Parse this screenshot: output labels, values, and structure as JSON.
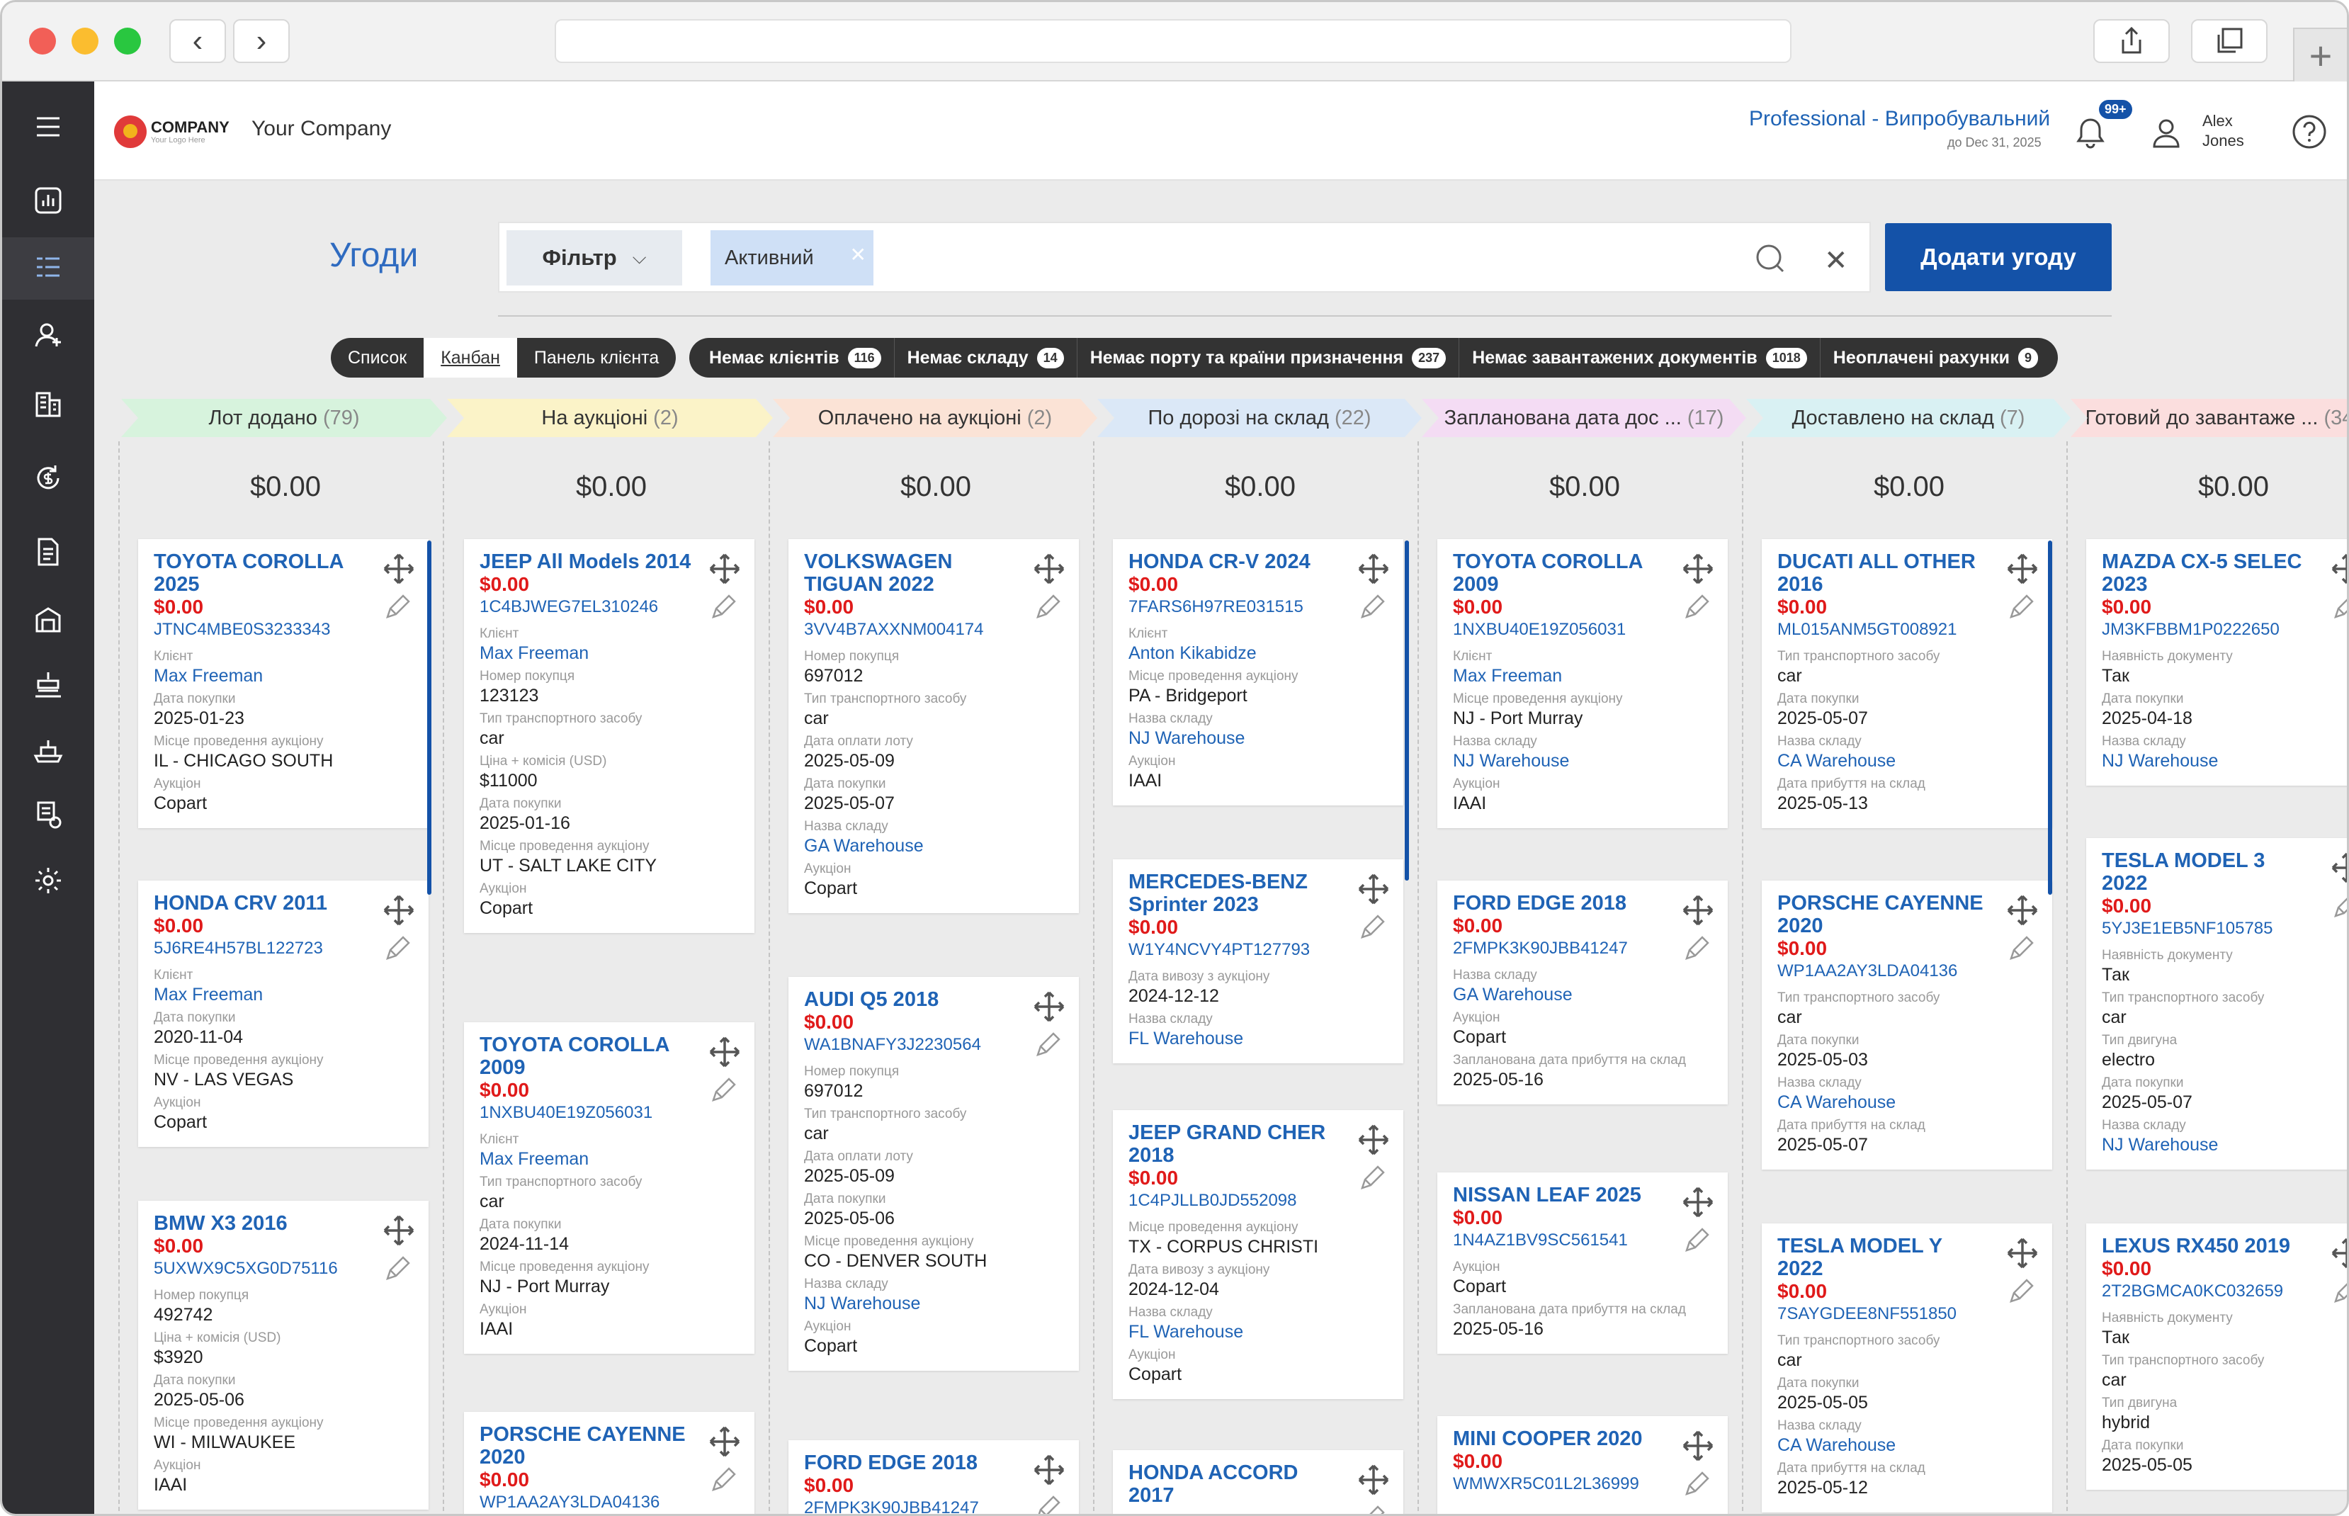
{
  "topbar": {
    "logo_text": "COMPANY",
    "logo_sub": "Your Logo Here",
    "company_name": "Your Company",
    "plan": "Professional - Випробувальний",
    "plan_until": "до Dec 31, 2025",
    "notifications_badge": "99+",
    "user_first": "Alex",
    "user_last": "Jones"
  },
  "page": {
    "title": "Угоди",
    "filter_label": "Фільтр",
    "active_chip": "Активний",
    "add_button": "Додати угоду"
  },
  "view_toggle": [
    "Список",
    "Канбан",
    "Панель клієнта"
  ],
  "quick_filters": [
    {
      "label": "Немає клієнтів",
      "count": "116"
    },
    {
      "label": "Немає складу",
      "count": "14"
    },
    {
      "label": "Немає порту та країни призначення",
      "count": "237"
    },
    {
      "label": "Немає завантажених документів",
      "count": "1018"
    },
    {
      "label": "Неоплачені рахунки",
      "count": "9"
    }
  ],
  "columns": [
    {
      "stage": "Лот додано",
      "count": "(79)",
      "color": "#d7f3dd",
      "amount": "$0.00",
      "cards": [
        {
          "title": "TOYOTA COROLLA 2025",
          "price": "$0.00",
          "vin": "JTNC4MBE0S3233343",
          "fields": [
            [
              "Клієнт",
              "Max Freeman",
              true
            ],
            [
              "Дата покупки",
              "2025-01-23",
              false
            ],
            [
              "Місце проведення аукціону",
              "IL - CHICAGO SOUTH",
              false
            ],
            [
              "Аукціон",
              "Copart",
              false
            ]
          ]
        },
        {
          "title": "HONDA CRV 2011",
          "price": "$0.00",
          "vin": "5J6RE4H57BL122723",
          "fields": [
            [
              "Клієнт",
              "Max Freeman",
              true
            ],
            [
              "Дата покупки",
              "2020-11-04",
              false
            ],
            [
              "Місце проведення аукціону",
              "NV - LAS VEGAS",
              false
            ],
            [
              "Аукціон",
              "Copart",
              false
            ]
          ]
        },
        {
          "title": "BMW X3 2016",
          "price": "$0.00",
          "vin": "5UXWX9C5XG0D75116",
          "fields": [
            [
              "Номер покупця",
              "492742",
              false
            ],
            [
              "Ціна + комісія (USD)",
              "$3920",
              false
            ],
            [
              "Дата покупки",
              "2025-05-06",
              false
            ],
            [
              "Місце проведення аукціону",
              "WI - MILWAUKEE",
              false
            ],
            [
              "Аукціон",
              "IAAI",
              false
            ]
          ]
        }
      ]
    },
    {
      "stage": "На аукціоні",
      "count": "(2)",
      "color": "#fbf3c8",
      "amount": "$0.00",
      "cards": [
        {
          "title": "JEEP All Models 2014",
          "price": "$0.00",
          "vin": "1C4BJWEG7EL310246",
          "fields": [
            [
              "Клієнт",
              "Max Freeman",
              true
            ],
            [
              "Номер покупця",
              "123123",
              false
            ],
            [
              "Тип транспортного засобу",
              "car",
              false
            ],
            [
              "Ціна + комісія (USD)",
              "$11000",
              false
            ],
            [
              "Дата покупки",
              "2025-01-16",
              false
            ],
            [
              "Місце проведення аукціону",
              "UT - SALT LAKE CITY",
              false
            ],
            [
              "Аукціон",
              "Copart",
              false
            ]
          ]
        },
        {
          "title": "TOYOTA COROLLA 2009",
          "price": "$0.00",
          "vin": "1NXBU40E19Z056031",
          "fields": [
            [
              "Клієнт",
              "Max Freeman",
              true
            ],
            [
              "Тип транспортного засобу",
              "car",
              false
            ],
            [
              "Дата покупки",
              "2024-11-14",
              false
            ],
            [
              "Місце проведення аукціону",
              "NJ - Port Murray",
              false
            ],
            [
              "Аукціон",
              "IAAI",
              false
            ]
          ]
        },
        {
          "title": "PORSCHE CAYENNE 2020",
          "price": "$0.00",
          "vin": "WP1AA2AY3LDA04136",
          "fields": []
        }
      ]
    },
    {
      "stage": "Оплачено на аукціоні",
      "count": "(2)",
      "color": "#fbe3d6",
      "amount": "$0.00",
      "cards": [
        {
          "title": "VOLKSWAGEN TIGUAN 2022",
          "price": "$0.00",
          "vin": "3VV4B7AXXNM004174",
          "fields": [
            [
              "Номер покупця",
              "697012",
              false
            ],
            [
              "Тип транспортного засобу",
              "car",
              false
            ],
            [
              "Дата оплати лоту",
              "2025-05-09",
              false
            ],
            [
              "Дата покупки",
              "2025-05-07",
              false
            ],
            [
              "Назва складу",
              "GA Warehouse",
              true
            ],
            [
              "Аукціон",
              "Copart",
              false
            ]
          ]
        },
        {
          "title": "AUDI Q5 2018",
          "price": "$0.00",
          "vin": "WA1BNAFY3J2230564",
          "fields": [
            [
              "Номер покупця",
              "697012",
              false
            ],
            [
              "Тип транспортного засобу",
              "car",
              false
            ],
            [
              "Дата оплати лоту",
              "2025-05-09",
              false
            ],
            [
              "Дата покупки",
              "2025-05-06",
              false
            ],
            [
              "Місце проведення аукціону",
              "CO - DENVER SOUTH",
              false
            ],
            [
              "Назва складу",
              "NJ Warehouse",
              true
            ],
            [
              "Аукціон",
              "Copart",
              false
            ]
          ]
        },
        {
          "title": "FORD EDGE 2018",
          "price": "$0.00",
          "vin": "2FMPK3K90JBB41247",
          "fields": []
        }
      ]
    },
    {
      "stage": "По дорозі на склад",
      "count": "(22)",
      "color": "#dbe8f7",
      "amount": "$0.00",
      "cards": [
        {
          "title": "HONDA CR-V 2024",
          "price": "$0.00",
          "vin": "7FARS6H97RE031515",
          "fields": [
            [
              "Клієнт",
              "Anton Kikabidze",
              true
            ],
            [
              "Місце проведення аукціону",
              "PA - Bridgeport",
              false
            ],
            [
              "Назва складу",
              "NJ Warehouse",
              true
            ],
            [
              "Аукціон",
              "IAAI",
              false
            ]
          ]
        },
        {
          "title": "MERCEDES-BENZ Sprinter 2023",
          "price": "$0.00",
          "vin": "W1Y4NCVY4PT127793",
          "fields": [
            [
              "Дата вивозу з аукціону",
              "2024-12-12",
              false
            ],
            [
              "Назва складу",
              "FL Warehouse",
              true
            ]
          ]
        },
        {
          "title": "JEEP GRAND CHER 2018",
          "price": "$0.00",
          "vin": "1C4PJLLB0JD552098",
          "fields": [
            [
              "Місце проведення аукціону",
              "TX - CORPUS CHRISTI",
              false
            ],
            [
              "Дата вивозу з аукціону",
              "2024-12-04",
              false
            ],
            [
              "Назва складу",
              "FL Warehouse",
              true
            ],
            [
              "Аукціон",
              "Copart",
              false
            ]
          ]
        },
        {
          "title": "HONDA ACCORD 2017",
          "price": "",
          "vin": "",
          "fields": []
        }
      ]
    },
    {
      "stage": "Запланована дата дос ...",
      "count": "(17)",
      "color": "#f4dcf4",
      "amount": "$0.00",
      "cards": [
        {
          "title": "TOYOTA COROLLA 2009",
          "price": "$0.00",
          "vin": "1NXBU40E19Z056031",
          "fields": [
            [
              "Клієнт",
              "Max Freeman",
              true
            ],
            [
              "Місце проведення аукціону",
              "NJ - Port Murray",
              false
            ],
            [
              "Назва складу",
              "NJ Warehouse",
              true
            ],
            [
              "Аукціон",
              "IAAI",
              false
            ]
          ]
        },
        {
          "title": "FORD EDGE 2018",
          "price": "$0.00",
          "vin": "2FMPK3K90JBB41247",
          "fields": [
            [
              "Назва складу",
              "GA Warehouse",
              true
            ],
            [
              "Аукціон",
              "Copart",
              false
            ],
            [
              "Запланована дата прибуття на склад",
              "2025-05-16",
              false
            ]
          ]
        },
        {
          "title": "NISSAN LEAF 2025",
          "price": "$0.00",
          "vin": "1N4AZ1BV9SC561541",
          "fields": [
            [
              "Аукціон",
              "Copart",
              false
            ],
            [
              "Запланована дата прибуття на склад",
              "2025-05-16",
              false
            ]
          ]
        },
        {
          "title": "MINI COOPER 2020",
          "price": "$0.00",
          "vin": "WMWXR5C01L2L36999",
          "fields": []
        }
      ]
    },
    {
      "stage": "Доставлено на склад",
      "count": "(7)",
      "color": "#d9f1f3",
      "amount": "$0.00",
      "cards": [
        {
          "title": "DUCATI ALL OTHER 2016",
          "price": "$0.00",
          "vin": "ML015ANM5GT008921",
          "fields": [
            [
              "Тип транспортного засобу",
              "car",
              false
            ],
            [
              "Дата покупки",
              "2025-05-07",
              false
            ],
            [
              "Назва складу",
              "CA Warehouse",
              true
            ],
            [
              "Дата прибуття на склад",
              "2025-05-13",
              false
            ]
          ]
        },
        {
          "title": "PORSCHE CAYENNE 2020",
          "price": "$0.00",
          "vin": "WP1AA2AY3LDA04136",
          "fields": [
            [
              "Тип транспортного засобу",
              "car",
              false
            ],
            [
              "Дата покупки",
              "2025-05-03",
              false
            ],
            [
              "Назва складу",
              "CA Warehouse",
              true
            ],
            [
              "Дата прибуття на склад",
              "2025-05-07",
              false
            ]
          ]
        },
        {
          "title": "TESLA MODEL Y 2022",
          "price": "$0.00",
          "vin": "7SAYGDEE8NF551850",
          "fields": [
            [
              "Тип транспортного засобу",
              "car",
              false
            ],
            [
              "Дата покупки",
              "2025-05-05",
              false
            ],
            [
              "Назва складу",
              "CA Warehouse",
              true
            ],
            [
              "Дата прибуття на склад",
              "2025-05-12",
              false
            ]
          ]
        }
      ]
    },
    {
      "stage": "Готовий до завантаже ...",
      "count": "(34",
      "color": "#fbdede",
      "amount": "$0.00",
      "cards": [
        {
          "title": "MAZDA CX-5 SELEC 2023",
          "price": "$0.00",
          "vin": "JM3KFBBM1P0222650",
          "fields": [
            [
              "Наявність документу",
              "Так",
              false
            ],
            [
              "Дата покупки",
              "2025-04-18",
              false
            ],
            [
              "Назва складу",
              "NJ Warehouse",
              true
            ]
          ]
        },
        {
          "title": "TESLA MODEL 3 2022",
          "price": "$0.00",
          "vin": "5YJ3E1EB5NF105785",
          "fields": [
            [
              "Наявність документу",
              "Так",
              false
            ],
            [
              "Тип транспортного засобу",
              "car",
              false
            ],
            [
              "Тип двигуна",
              "electro",
              false
            ],
            [
              "Дата покупки",
              "2025-05-07",
              false
            ],
            [
              "Назва складу",
              "NJ Warehouse",
              true
            ]
          ]
        },
        {
          "title": "LEXUS RX450 2019",
          "price": "$0.00",
          "vin": "2T2BGMCA0KC032659",
          "fields": [
            [
              "Наявність документу",
              "Так",
              false
            ],
            [
              "Тип транспортного засобу",
              "car",
              false
            ],
            [
              "Тип двигуна",
              "hybrid",
              false
            ],
            [
              "Дата покупки",
              "2025-05-05",
              false
            ]
          ]
        }
      ]
    }
  ]
}
